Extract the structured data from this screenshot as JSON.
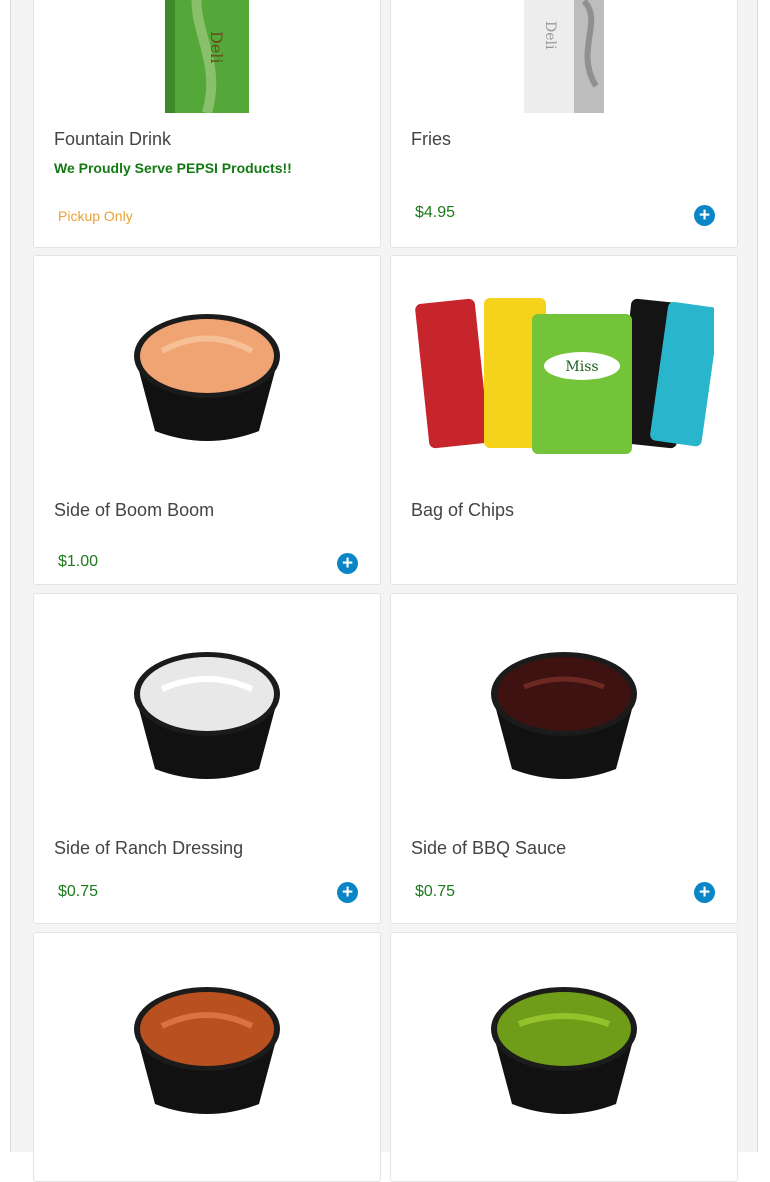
{
  "items": [
    {
      "name": "Fountain Drink",
      "note": "We Proudly Serve PEPSI Products!!",
      "pickup": "Pickup Only",
      "price": null,
      "image_icon": "cup-icon"
    },
    {
      "name": "Fries",
      "note": null,
      "pickup": null,
      "price": "$4.95",
      "image_icon": "cup-icon"
    },
    {
      "name": "Side of Boom Boom",
      "price": "$1.00",
      "image_icon": "sauce-cup-icon",
      "sauce_color": "#f0a373"
    },
    {
      "name": "Bag of Chips",
      "price": null,
      "image_icon": "chips-bags-icon"
    },
    {
      "name": "Side of Ranch Dressing",
      "price": "$0.75",
      "image_icon": "sauce-cup-icon",
      "sauce_color": "#e8e8e8"
    },
    {
      "name": "Side of BBQ Sauce",
      "price": "$0.75",
      "image_icon": "sauce-cup-icon",
      "sauce_color": "#3e1210"
    },
    {
      "name": "",
      "price": null,
      "image_icon": "sauce-cup-icon",
      "sauce_color": "#b9501f"
    },
    {
      "name": "",
      "price": null,
      "image_icon": "sauce-cup-icon",
      "sauce_color": "#6f9d19"
    }
  ],
  "add_button_symbol": "+"
}
